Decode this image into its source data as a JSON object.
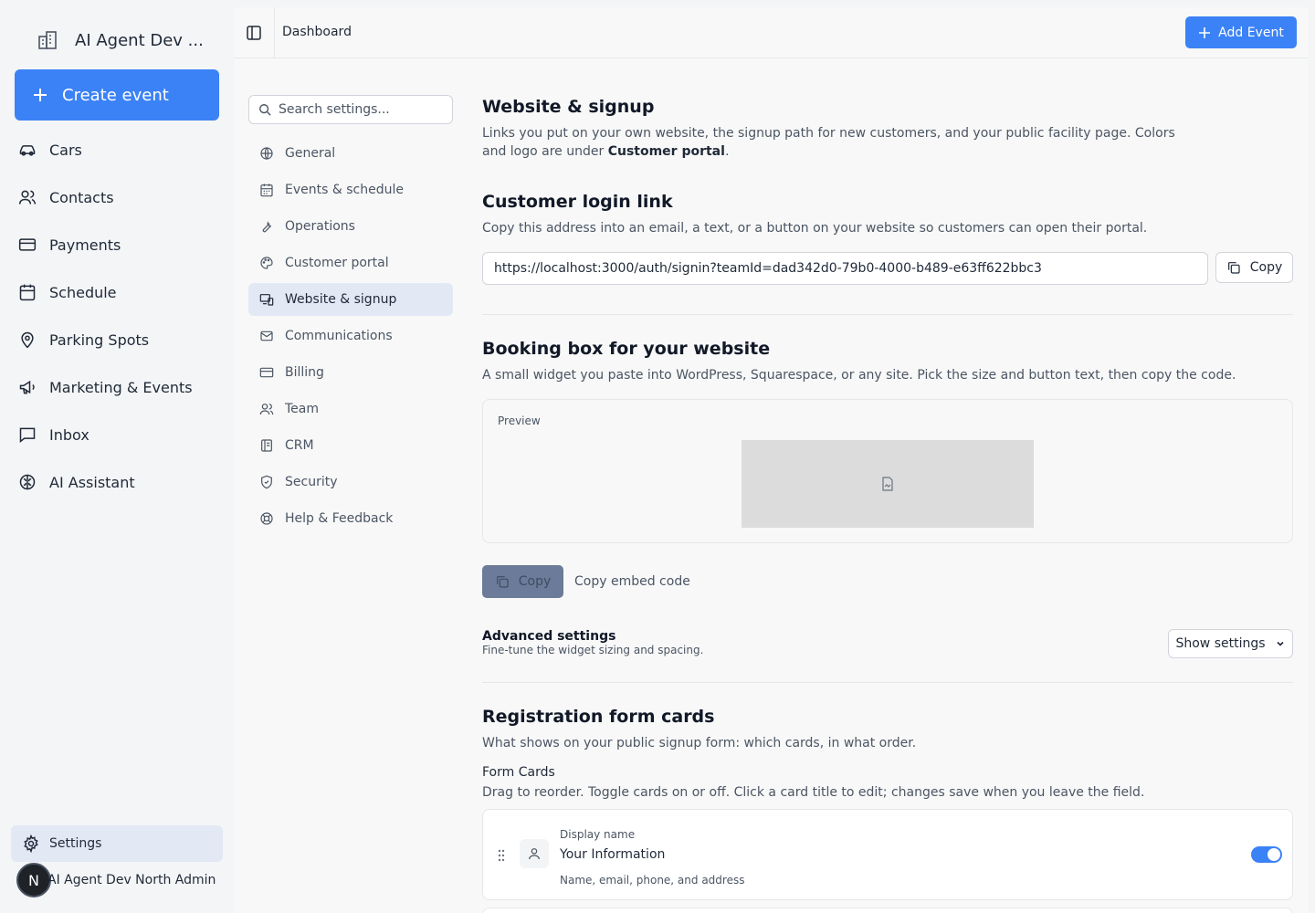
{
  "app": {
    "brand": "AI Agent Dev ...",
    "create_button": "Create event",
    "nav": [
      {
        "label": "Cars",
        "icon": "car-icon"
      },
      {
        "label": "Contacts",
        "icon": "users-icon"
      },
      {
        "label": "Payments",
        "icon": "credit-card-icon"
      },
      {
        "label": "Schedule",
        "icon": "calendar-icon"
      },
      {
        "label": "Parking Spots",
        "icon": "map-pin-icon"
      },
      {
        "label": "Marketing & Events",
        "icon": "megaphone-icon"
      },
      {
        "label": "Inbox",
        "icon": "message-square-icon"
      },
      {
        "label": "AI Assistant",
        "icon": "brain-icon"
      }
    ],
    "settings_label": "Settings",
    "user": {
      "initial": "N",
      "name": "AI Agent Dev North Admin"
    }
  },
  "topbar": {
    "breadcrumb": "Dashboard",
    "add_event": "Add Event"
  },
  "subnav": {
    "search_placeholder": "Search settings...",
    "items": [
      {
        "label": "General",
        "icon": "globe-icon"
      },
      {
        "label": "Events & schedule",
        "icon": "calendar-icon"
      },
      {
        "label": "Operations",
        "icon": "wrench-icon"
      },
      {
        "label": "Customer portal",
        "icon": "palette-icon"
      },
      {
        "label": "Website & signup",
        "icon": "monitor-smartphone-icon",
        "active": true
      },
      {
        "label": "Communications",
        "icon": "mail-icon"
      },
      {
        "label": "Billing",
        "icon": "credit-card-icon"
      },
      {
        "label": "Team",
        "icon": "users-icon"
      },
      {
        "label": "CRM",
        "icon": "contact-icon"
      },
      {
        "label": "Security",
        "icon": "shield-icon"
      },
      {
        "label": "Help & Feedback",
        "icon": "life-buoy-icon"
      }
    ]
  },
  "content": {
    "page_title": "Website & signup",
    "page_desc_before": "Links you put on your own website, the signup path for new customers, and your public facility page. Colors and logo are under ",
    "page_desc_bold": "Customer portal",
    "page_desc_after": ".",
    "login": {
      "title": "Customer login link",
      "desc": "Copy this address into an email, a text, or a button on your website so customers can open their portal.",
      "url": "https://localhost:3000/auth/signin?teamId=dad342d0-79b0-4000-b489-e63ff622bbc3",
      "copy": "Copy"
    },
    "booking": {
      "title": "Booking box for your website",
      "desc": "A small widget you paste into WordPress, Squarespace, or any site. Pick the size and button text, then copy the code.",
      "preview_label": "Preview",
      "copy": "Copy",
      "copy_label": "Copy embed code",
      "advanced_title": "Advanced settings",
      "advanced_desc": "Fine-tune the widget sizing and spacing.",
      "show_settings": "Show settings"
    },
    "registration": {
      "title": "Registration form cards",
      "desc": "What shows on your public signup form: which cards, in what order.",
      "form_cards_label": "Form Cards",
      "form_cards_desc": "Drag to reorder. Toggle cards on or off. Click a card title to edit; changes save when you leave the field.",
      "cards": [
        {
          "label": "Display name",
          "title": "Your Information",
          "desc": "Name, email, phone, and address",
          "enabled": true,
          "icon": "user-icon"
        }
      ]
    }
  },
  "colors": {
    "accent": "#3b82f6",
    "active_bg": "#e3e8f5"
  }
}
